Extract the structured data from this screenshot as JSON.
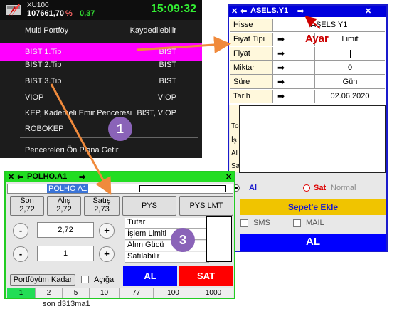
{
  "ticker": {
    "symbol": "XU100",
    "value": "107661,70",
    "pct": "%",
    "change": "0,37",
    "time": "15:09:32"
  },
  "context_menu": {
    "items": [
      {
        "label": "Multi Portföy",
        "right": "Kaydedilebilir"
      },
      {
        "label": "BIST 1.Tip",
        "right": "BIST"
      },
      {
        "label": "BIST 2.Tip",
        "right": "BIST"
      },
      {
        "label": "BIST 3.Tip",
        "right": "BIST"
      },
      {
        "label": "VIOP",
        "right": "VIOP"
      },
      {
        "label": "KEP, Kademeli Emir Penceresi",
        "right": "BIST, VIOP"
      },
      {
        "label": "ROBOKEP",
        "right": ""
      },
      {
        "label": "Pencereleri Ön Plana Getir",
        "right": ""
      }
    ],
    "selected_index": 1
  },
  "asels_window": {
    "title": "ASELS.Y1",
    "annotation_label": "Ayar",
    "rows": [
      {
        "label": "Hisse",
        "value": "ASELS Y1"
      },
      {
        "label": "Fiyat Tipi",
        "value": "Limit"
      },
      {
        "label": "Fiyat",
        "value": ""
      },
      {
        "label": "Miktar",
        "value": "0"
      },
      {
        "label": "Süre",
        "value": "Gün"
      },
      {
        "label": "Tarih",
        "value": "02.06.2020"
      }
    ],
    "side_letters": [
      "To",
      "İş",
      "Al",
      "Sa"
    ],
    "badge": "1",
    "radio_buy": "Al",
    "radio_sell": "Sat",
    "normal_label": "Normal",
    "basket_label": "Sepet'e Ekle",
    "sms_label": "SMS",
    "mail_label": "MAIL",
    "buy_label": "AL"
  },
  "polho_window": {
    "title": "POLHO.A1",
    "symbol": "POLHO A1",
    "quotes": [
      {
        "label": "Son",
        "value": "2,72"
      },
      {
        "label": "Alış",
        "value": "2,72"
      },
      {
        "label": "Satış",
        "value": "2,73"
      }
    ],
    "pys_label": "PYS",
    "pys_lmt_label": "PYS LMT",
    "minus": "-",
    "plus": "+",
    "price_value": "2,72",
    "qty_value": "1",
    "info_rows": [
      "Tutar",
      "İşlem Limiti",
      "Alım Gücü",
      "Satılabilir"
    ],
    "badge": "3",
    "portfolio_label": "Portföyüm Kadar",
    "aciga_label": "Açığa",
    "buy_label": "AL",
    "sell_label": "SAT",
    "lots": [
      "1",
      "2",
      "5",
      "10",
      "77",
      "100",
      "1000"
    ]
  },
  "bottom_row_text": "son d313ma1",
  "colors": {
    "menu_selected": "#ff00ff",
    "asels_title": "#0000dd",
    "polho_title": "#22dd22",
    "buy": "#0000ff",
    "sell": "#ff0000",
    "basket": "#f0c400",
    "arrow": "#f08a3c",
    "badge": "#8a63b8"
  }
}
